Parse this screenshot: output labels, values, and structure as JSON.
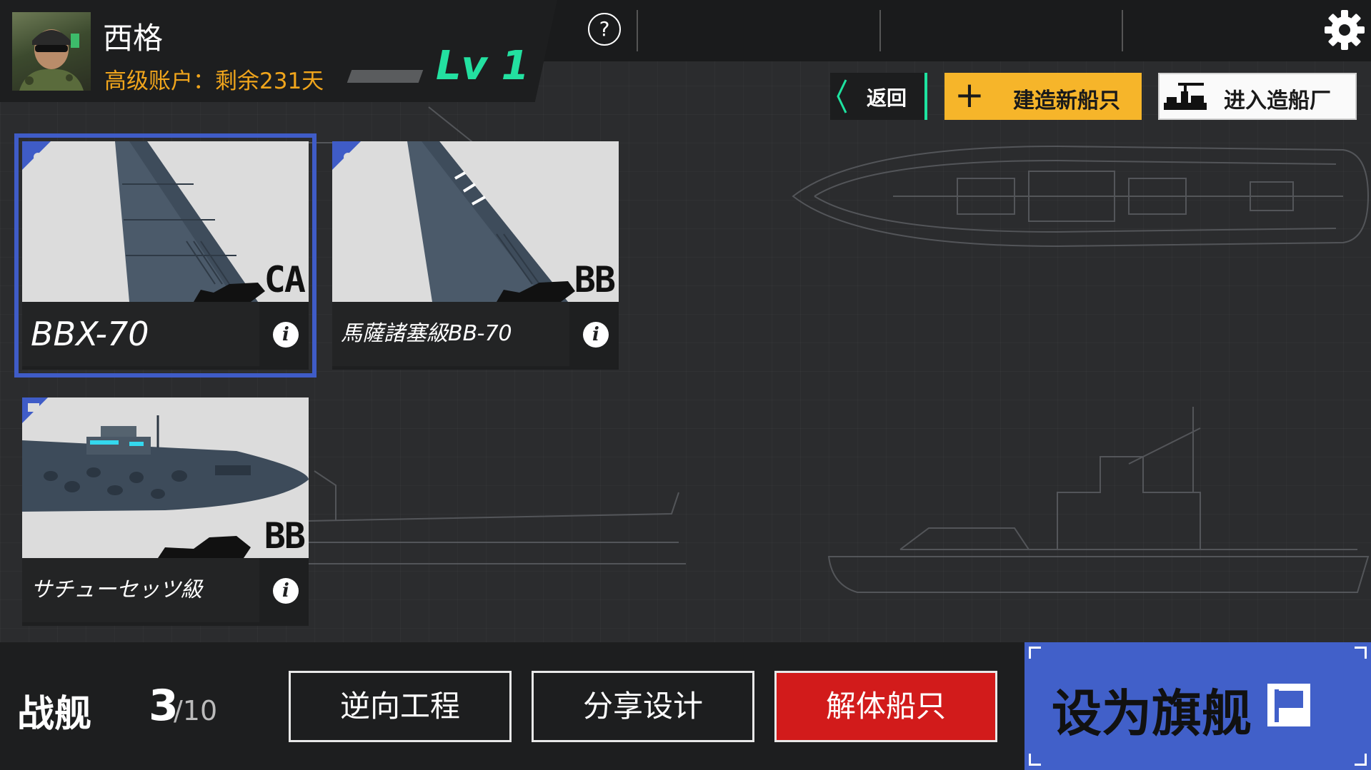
{
  "player": {
    "name": "西格",
    "account_status": "高级账户：剩余231天",
    "level": "Lv 1"
  },
  "topbar": {
    "help_symbol": "?"
  },
  "actions": {
    "back_label": "返回",
    "build_label": "建造新船只",
    "build_symbol": "+",
    "shipyard_label": "进入造船厂"
  },
  "ships": [
    {
      "name": "BBX-70",
      "class": "CA",
      "selected": true
    },
    {
      "name": "馬薩諸塞級BB-70",
      "class": "BB",
      "selected": false
    },
    {
      "name": "サチューセッツ級",
      "class": "BB",
      "selected": false,
      "flagship": true
    }
  ],
  "info_symbol": "i",
  "fleet": {
    "label": "战舰",
    "count": "3",
    "max": "/10"
  },
  "bottom_actions": {
    "reverse_engineer": "逆向工程",
    "share_design": "分享设计",
    "dismantle": "解体船只",
    "set_flagship": "设为旗舰"
  },
  "colors": {
    "accent_green": "#1ee3a0",
    "build_yellow": "#f6b52a",
    "danger_red": "#d21b1b",
    "select_blue": "#3f5cc7",
    "account_orange": "#f0a51c"
  }
}
